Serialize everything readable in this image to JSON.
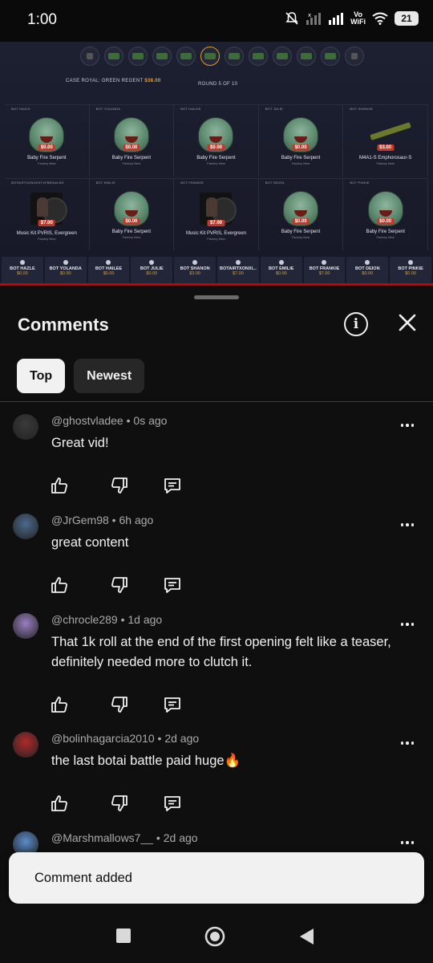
{
  "status_bar": {
    "time": "1:00",
    "vowifi_top": "Vo",
    "vowifi_bottom": "WiFi",
    "battery": "21"
  },
  "video": {
    "case_label": "CASE",
    "case_name": "ROYAL: GREEN REGENT",
    "case_price": "$38.00",
    "round_text": "ROUND 5 OF 10",
    "progress_fraction": 1.0,
    "row1": [
      {
        "player": "BOT HAZLE",
        "item": "Baby Fire Serpent",
        "condition": "Factory New",
        "price": "$0.00",
        "kind": "serpent"
      },
      {
        "player": "BOT YOLANDA",
        "item": "Baby Fire Serpent",
        "condition": "Factory New",
        "price": "$0.00",
        "kind": "serpent"
      },
      {
        "player": "BOT HAILEE",
        "item": "Baby Fire Serpent",
        "condition": "Factory New",
        "price": "$0.00",
        "kind": "serpent"
      },
      {
        "player": "BOT JULIE",
        "item": "Baby Fire Serpent",
        "condition": "Factory New",
        "price": "$0.00",
        "kind": "serpent"
      },
      {
        "player": "BOT SHANON",
        "item": "M4A1-S Emphorosaur-S",
        "condition": "Factory New",
        "price": "$3.00",
        "kind": "rifle"
      }
    ],
    "row2": [
      {
        "player": "BOTAIRTXONXDSTXFBBSAILBS",
        "item": "Music Kit PVRIS, Evergreen",
        "condition": "Factory New",
        "price": "$7.00",
        "kind": "music"
      },
      {
        "player": "BOT EMILIE",
        "item": "Baby Fire Serpent",
        "condition": "Factory New",
        "price": "$0.00",
        "kind": "serpent"
      },
      {
        "player": "BOT FRANKIE",
        "item": "Music Kit PVRIS, Evergreen",
        "condition": "Factory New",
        "price": "$7.00",
        "kind": "music"
      },
      {
        "player": "BOT DEION",
        "item": "Baby Fire Serpent",
        "condition": "Factory New",
        "price": "$0.00",
        "kind": "serpent"
      },
      {
        "player": "BOT PINKIE",
        "item": "Baby Fire Serpent",
        "condition": "Factory New",
        "price": "$0.00",
        "kind": "serpent"
      }
    ],
    "bots": [
      {
        "name": "BOT HAZLE",
        "value": "$0.00"
      },
      {
        "name": "BOT YOLANDA",
        "value": "$0.00"
      },
      {
        "name": "BOT HAILEE",
        "value": "$0.00"
      },
      {
        "name": "BOT JULIE",
        "value": "$0.00"
      },
      {
        "name": "BOT SHANON",
        "value": "$3.00"
      },
      {
        "name": "BOTAIRTXONXI...",
        "value": "$7.00"
      },
      {
        "name": "BOT EMILIE",
        "value": "$0.00"
      },
      {
        "name": "BOT FRANKIE",
        "value": "$7.00"
      },
      {
        "name": "BOT DEION",
        "value": "$0.00"
      },
      {
        "name": "BOT PINKIE",
        "value": "$0.00"
      }
    ]
  },
  "comments_panel": {
    "title": "Comments",
    "tabs": [
      {
        "label": "Top",
        "active": true
      },
      {
        "label": "Newest",
        "active": false
      }
    ],
    "comments": [
      {
        "handle": "@ghostvladee",
        "time": "0s ago",
        "text": "Great vid!",
        "avatar_color": "#3a3a3a"
      },
      {
        "handle": "@JrGem98",
        "time": "6h ago",
        "text": "great content",
        "avatar_color": "#4a6a8c"
      },
      {
        "handle": "@chrocle289",
        "time": "1d ago",
        "text": "That 1k roll at the end of the first opening felt like a teaser, definitely needed more to clutch it.",
        "avatar_color": "#9a7fc0"
      },
      {
        "handle": "@bolinhagarcia2010",
        "time": "2d ago",
        "text": "the last botai battle paid huge🔥",
        "avatar_color": "#b02a2a"
      },
      {
        "handle": "@Marshmallows7__",
        "time": "2d ago",
        "text": "",
        "avatar_color": "#5a8cc8"
      }
    ]
  },
  "snackbar": {
    "message": "Comment added"
  },
  "colors": {
    "background": "#0f0f0f",
    "text_primary": "#f1f1f1",
    "text_secondary": "#aaaaaa",
    "chip_inactive": "#272727",
    "snackbar_bg": "#f1f1f1"
  },
  "icons": {
    "info": "info-icon",
    "close": "close-icon",
    "like": "thumb-up-icon",
    "dislike": "thumb-down-icon",
    "reply": "reply-icon",
    "more": "more-vertical-icon",
    "nav_recents": "square-icon",
    "nav_home": "circle-icon",
    "nav_back": "triangle-back-icon"
  }
}
